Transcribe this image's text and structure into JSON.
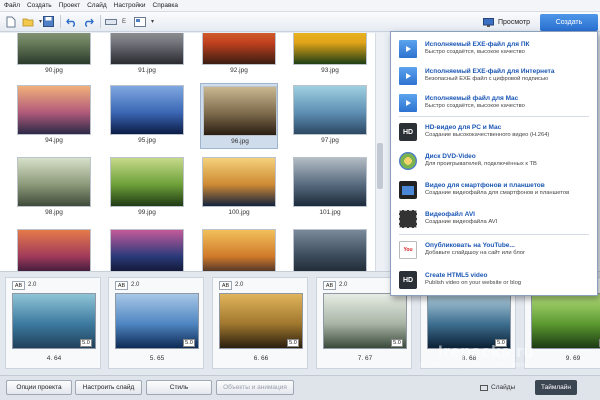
{
  "menu": [
    "Файл",
    "Создать",
    "Проект",
    "Слайд",
    "Настройки",
    "Справка"
  ],
  "toolbar": {
    "resolution_label": "E",
    "tab_preview": "Просмотр",
    "tab_create": "Создать"
  },
  "grid": {
    "thumbnails": [
      {
        "name": "90.jpg",
        "colors": [
          "#2b3a2d",
          "#6a7d5b",
          "#a9b8a0"
        ]
      },
      {
        "name": "91.jpg",
        "colors": [
          "#2a2a30",
          "#73757c",
          "#b9b6ae"
        ]
      },
      {
        "name": "92.jpg",
        "colors": [
          "#3b1d12",
          "#c2411f",
          "#e58b3d"
        ]
      },
      {
        "name": "93.jpg",
        "colors": [
          "#1e3f15",
          "#e1a419",
          "#f5cb2e"
        ]
      },
      {
        "name": "94.jpg",
        "colors": [
          "#2b2947",
          "#b15a7a",
          "#f0b07a"
        ]
      },
      {
        "name": "95.jpg",
        "colors": [
          "#0c1c46",
          "#3b67b5",
          "#7fa8e0"
        ]
      },
      {
        "name": "96.jpg",
        "colors": [
          "#2a1e12",
          "#7d6a4c",
          "#c9b790"
        ]
      },
      {
        "name": "97.jpg",
        "colors": [
          "#2c4863",
          "#5e8fb4",
          "#9ed0e0"
        ]
      },
      {
        "name": "98.jpg",
        "colors": [
          "#3f4a3a",
          "#8d9a7a",
          "#d7e0ca"
        ]
      },
      {
        "name": "99.jpg",
        "colors": [
          "#203a14",
          "#6ea13a",
          "#c6d98a"
        ]
      },
      {
        "name": "100.jpg",
        "colors": [
          "#14233e",
          "#cf8a34",
          "#f4d17a"
        ]
      },
      {
        "name": "101.jpg",
        "colors": [
          "#1c2a3a",
          "#586b7f",
          "#b3bcc4"
        ]
      },
      {
        "name": "",
        "colors": [
          "#1a1030",
          "#a03a5a",
          "#e57a4a"
        ]
      },
      {
        "name": "",
        "colors": [
          "#0a0a1a",
          "#2a3a7a",
          "#c45a9a"
        ]
      },
      {
        "name": "",
        "colors": [
          "#1a1a2a",
          "#d07a2a",
          "#f2c05a"
        ]
      },
      {
        "name": "",
        "colors": [
          "#18202a",
          "#3a4a5a",
          "#7a8a9a"
        ]
      }
    ]
  },
  "timeline": {
    "slides": [
      {
        "ab": "AB",
        "transition": "2.0",
        "duration": "5.0",
        "label": "4. 64",
        "colors": [
          "#20405a",
          "#3d7aa0",
          "#8fc4d6"
        ]
      },
      {
        "ab": "AB",
        "transition": "2.0",
        "duration": "5.0",
        "label": "5. 65",
        "colors": [
          "#0e2a55",
          "#4f86c2",
          "#a7c7e6"
        ]
      },
      {
        "ab": "AB",
        "transition": "2.0",
        "duration": "5.0",
        "label": "6. 66",
        "colors": [
          "#2a1e0e",
          "#a0782e",
          "#e0b45c"
        ]
      },
      {
        "ab": "AB",
        "transition": "2.0",
        "duration": "5.0",
        "label": "7. 67",
        "colors": [
          "#3a4a3a",
          "#a9b4a6",
          "#e6ece4"
        ]
      },
      {
        "ab": "AB",
        "transition": "2.0",
        "duration": "5.0",
        "label": "8. 68",
        "colors": [
          "#0a2035",
          "#3e6f90",
          "#b3d0de"
        ]
      },
      {
        "ab": "AB",
        "transition": "2.0",
        "duration": "5.0",
        "label": "9. 69",
        "colors": [
          "#1c3a14",
          "#5b9a30",
          "#b4dc7a"
        ]
      }
    ]
  },
  "bottom": {
    "project_options": "Опции проекта",
    "configure_slide": "Настроить слайд",
    "style": "Стиль",
    "objects_animation": "Объекты и анимация",
    "slides_tab": "Слайды",
    "timeline_tab": "Таймлайн"
  },
  "create_menu": {
    "options": [
      {
        "icon": "play-icon",
        "title": "Исполняемый EXE-файл для ПК",
        "subtitle": "Быстро создаётся, высокое качество"
      },
      {
        "icon": "play-icon",
        "title": "Исполняемый EXE-файл для Интернета",
        "subtitle": "Безопасный EXE файл с цифровой подписью"
      },
      {
        "icon": "play-icon",
        "title": "Исполняемый файл для Mac",
        "subtitle": "Быстро создаётся, высокое качество"
      },
      {
        "icon": "hd-icon",
        "title": "HD-видео для PC и Mac",
        "subtitle": "Создание высококачественного видео (H.264)"
      },
      {
        "icon": "dvd-icon",
        "title": "Диск DVD-Video",
        "subtitle": "Для проигрывателей, подключённых к ТВ"
      },
      {
        "icon": "phone-icon",
        "title": "Видео для смартфонов и планшетов",
        "subtitle": "Создание видеофайла для смартфонов и планшетов"
      },
      {
        "icon": "film-icon",
        "title": "Видеофайл AVI",
        "subtitle": "Создание видеофайла AVI"
      },
      {
        "icon": "youtube-icon",
        "title": "Опубликовать на YouTube...",
        "subtitle": "Добавьте слайдшоу на сайт или блог"
      },
      {
        "icon": "hd-icon",
        "title": "Create HTML5 video",
        "subtitle": "Publish video on your website or blog"
      }
    ],
    "youtube_icon_text": "You",
    "hd_icon_text": "HD"
  },
  "watermark": {
    "main": "Irepacks.ru",
    "sub": "РЕПАКИ ОТ ЦЕНТРА ПОРТАТИВНЫХ"
  }
}
